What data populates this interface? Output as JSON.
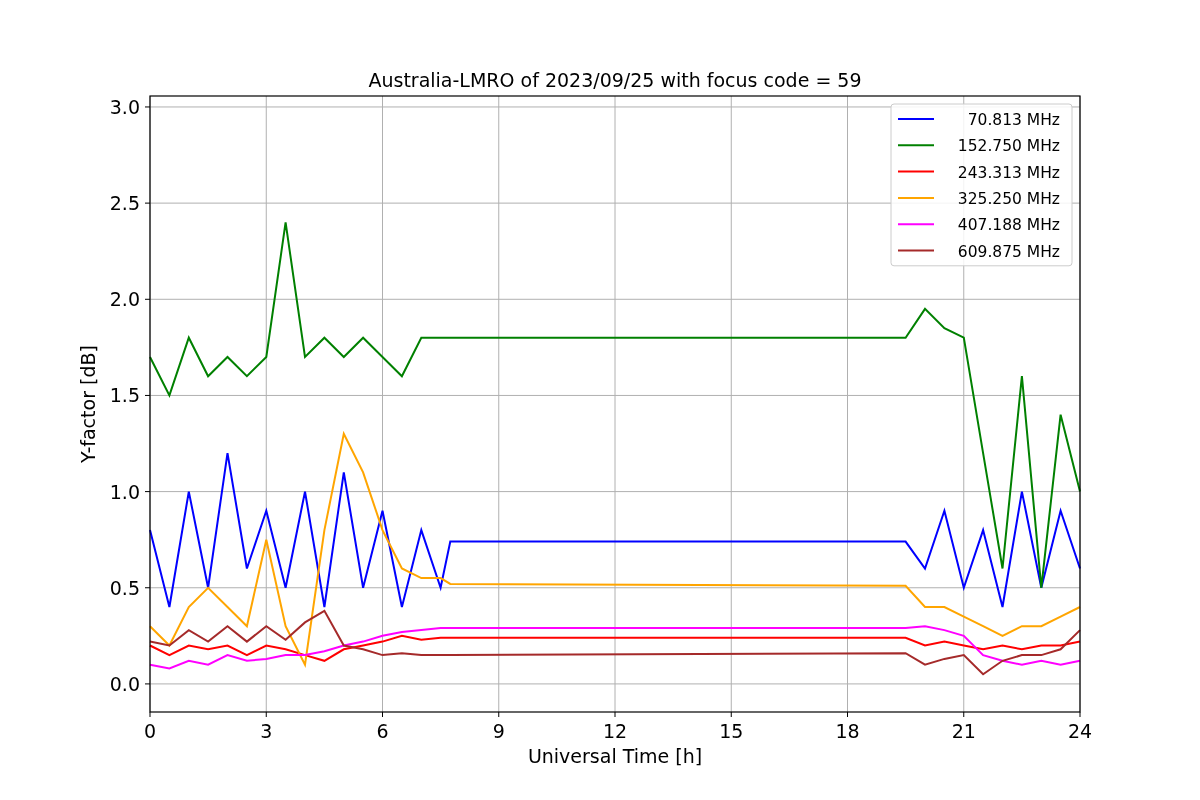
{
  "chart": {
    "chart_data": {
      "type": "line",
      "title": "Australia-LMRO of 2023/09/25 with focus code = 59",
      "xlabel": "Universal Time [h]",
      "ylabel": "Y-factor [dB]",
      "x": [
        0,
        0.5,
        1,
        1.5,
        2,
        2.5,
        3,
        3.5,
        4,
        4.5,
        5,
        5.5,
        6,
        6.5,
        7,
        7.5,
        7.75,
        19.5,
        20,
        20.5,
        21,
        21.5,
        22,
        22.5,
        23,
        23.5,
        24
      ],
      "series": [
        {
          "name": "70.813 MHz",
          "color": "#0000ff",
          "values": [
            0.8,
            0.4,
            1.0,
            0.5,
            1.2,
            0.6,
            0.9,
            0.5,
            1.0,
            0.4,
            1.1,
            0.5,
            0.9,
            0.4,
            0.8,
            0.5,
            0.74,
            0.74,
            0.6,
            0.9,
            0.5,
            0.8,
            0.4,
            1.0,
            0.5,
            0.9,
            0.6
          ]
        },
        {
          "name": "152.750 MHz",
          "color": "#008000",
          "values": [
            1.7,
            1.5,
            1.8,
            1.6,
            1.7,
            1.6,
            1.7,
            2.4,
            1.7,
            1.8,
            1.7,
            1.8,
            1.7,
            1.6,
            1.8,
            1.8,
            1.8,
            1.8,
            1.95,
            1.85,
            1.8,
            1.2,
            0.6,
            1.6,
            0.5,
            1.4,
            1.0
          ]
        },
        {
          "name": "243.313 MHz",
          "color": "#ff0000",
          "values": [
            0.2,
            0.15,
            0.2,
            0.18,
            0.2,
            0.15,
            0.2,
            0.18,
            0.15,
            0.12,
            0.18,
            0.2,
            0.22,
            0.25,
            0.23,
            0.24,
            0.24,
            0.24,
            0.2,
            0.22,
            0.2,
            0.18,
            0.2,
            0.18,
            0.2,
            0.2,
            0.22
          ]
        },
        {
          "name": "325.250 MHz",
          "color": "#ffa500",
          "values": [
            0.3,
            0.2,
            0.4,
            0.5,
            0.4,
            0.3,
            0.75,
            0.3,
            0.1,
            0.8,
            1.3,
            1.1,
            0.8,
            0.6,
            0.55,
            0.55,
            0.52,
            0.51,
            0.4,
            0.4,
            0.35,
            0.3,
            0.25,
            0.3,
            0.3,
            0.35,
            0.4
          ]
        },
        {
          "name": "407.188 MHz",
          "color": "#ff00ff",
          "values": [
            0.1,
            0.08,
            0.12,
            0.1,
            0.15,
            0.12,
            0.13,
            0.15,
            0.15,
            0.17,
            0.2,
            0.22,
            0.25,
            0.27,
            0.28,
            0.29,
            0.29,
            0.29,
            0.3,
            0.28,
            0.25,
            0.15,
            0.12,
            0.1,
            0.12,
            0.1,
            0.12
          ]
        },
        {
          "name": "609.875 MHz",
          "color": "#a52a2a",
          "values": [
            0.22,
            0.2,
            0.28,
            0.22,
            0.3,
            0.22,
            0.3,
            0.23,
            0.32,
            0.38,
            0.2,
            0.18,
            0.15,
            0.16,
            0.15,
            0.15,
            0.15,
            0.16,
            0.1,
            0.13,
            0.15,
            0.05,
            0.12,
            0.15,
            0.15,
            0.18,
            0.28
          ]
        }
      ],
      "grid": true,
      "legend": true,
      "xlim": [
        0,
        24
      ],
      "ylim": [
        -0.146,
        3.057
      ],
      "xticks": [
        0,
        3,
        6,
        9,
        12,
        15,
        18,
        21,
        24
      ],
      "yticks": [
        {
          "value": 0,
          "label": "0.0"
        },
        {
          "value": 0.5,
          "label": "0.5"
        },
        {
          "value": 1,
          "label": "1.0"
        },
        {
          "value": 1.5,
          "label": "1.5"
        },
        {
          "value": 2,
          "label": "2.0"
        },
        {
          "value": 2.5,
          "label": "2.5"
        },
        {
          "value": 3,
          "label": "3.0"
        }
      ]
    }
  }
}
